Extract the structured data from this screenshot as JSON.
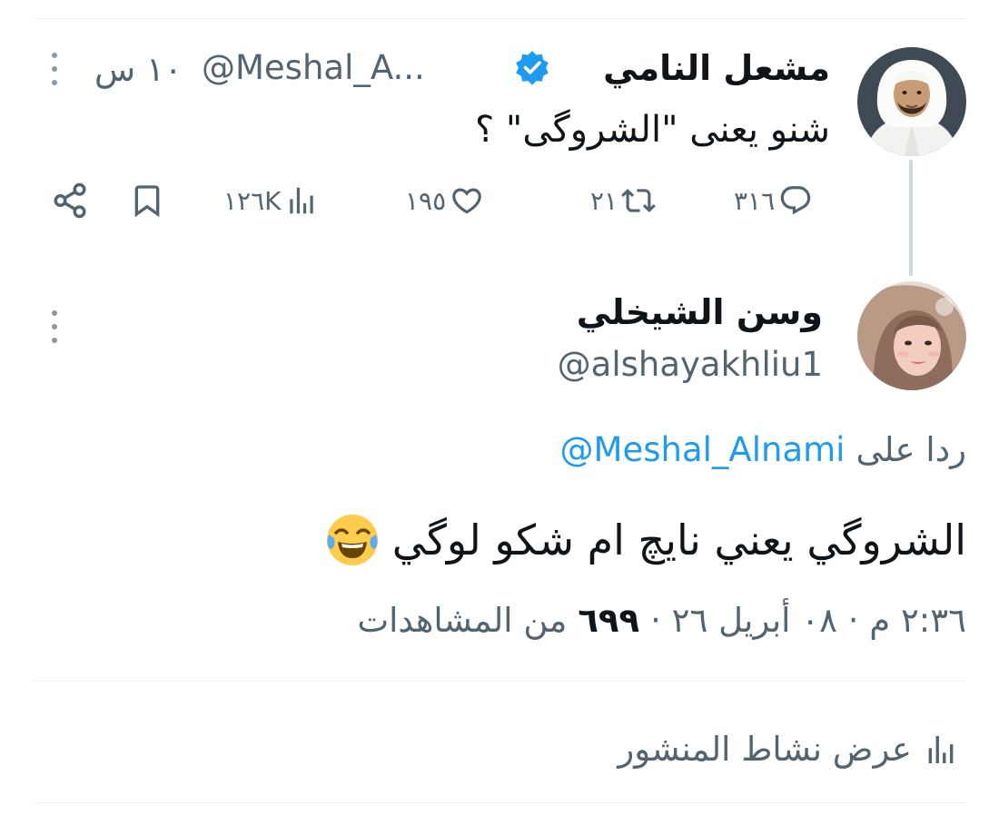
{
  "original_tweet": {
    "author_name": "مشعل النامي",
    "handle": "@Meshal_A...",
    "time": "١٠ س",
    "text": "شنو يعنى \"الشروگى\" ؟",
    "actions": {
      "replies": "٣١٦",
      "retweets": "٢١",
      "likes": "١٩٥",
      "views": "١٢٦K"
    }
  },
  "reply_tweet": {
    "author_name": "وسن الشيخلي",
    "handle": "@alshayakhliu1",
    "replying_to_prefix": "ردا على",
    "replying_to_handle": "@Meshal_Alnami",
    "text": "الشروگي يعني نايچ ام شكو لوگي",
    "timestamp": "٢:٣٦ م · ٠٨ أبريل ٢٦ ·",
    "view_count": "٦٩٩",
    "view_suffix": "من المشاهدات"
  },
  "post_activity": {
    "label": "عرض نشاط المنشور"
  },
  "colors": {
    "link": "#1d9bf0",
    "secondary_text": "#536471",
    "thread_line": "#cfd9de",
    "verified": "#1d9bf0"
  },
  "icons": [
    "more-icon",
    "verified-badge-icon",
    "reply-icon",
    "retweet-icon",
    "like-icon",
    "views-icon",
    "bookmark-icon",
    "share-icon",
    "laughing-emoji",
    "activity-icon"
  ]
}
